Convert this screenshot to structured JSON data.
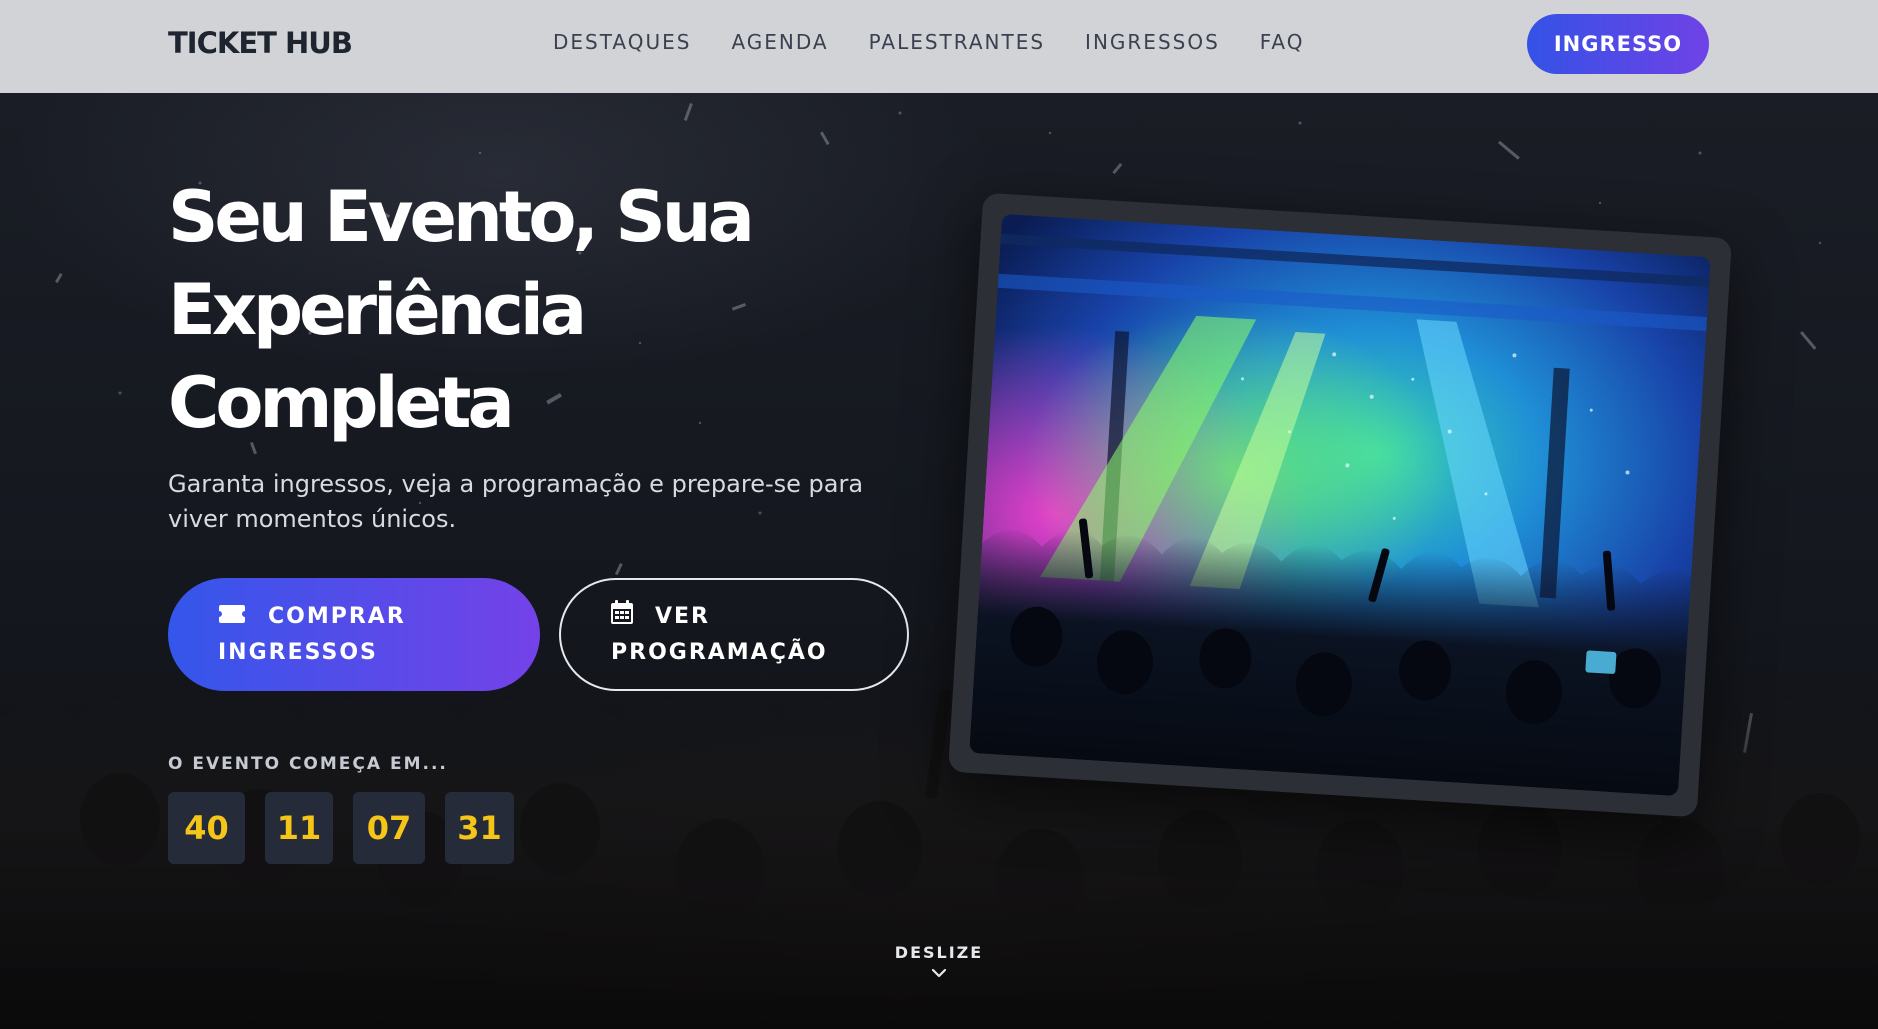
{
  "nav": {
    "logo": "TICKET HUB",
    "links": [
      "DESTAQUES",
      "AGENDA",
      "PALESTRANTES",
      "INGRESSOS",
      "FAQ"
    ],
    "cta": "INGRESSO"
  },
  "hero": {
    "headline_lines": [
      "Seu Evento, Sua",
      "Experiência",
      "Completa"
    ],
    "subtitle_lines": [
      "Garanta ingressos, veja a programação e prepare-se para",
      "viver momentos únicos."
    ],
    "primary_button": {
      "line1": "COMPRAR",
      "line2": "INGRESSOS",
      "icon": "ticket-icon"
    },
    "secondary_button": {
      "line1": "VER",
      "line2": "PROGRAMAÇÃO",
      "icon": "calendar-icon"
    },
    "countdown_label": "O EVENTO COMEÇA EM...",
    "countdown": [
      "40",
      "11",
      "07",
      "31"
    ],
    "scroll_label": "DESLIZE",
    "scroll_icon": "chevron-down-icon"
  },
  "colors": {
    "accent_start": "#3456ea",
    "accent_end": "#7442e8",
    "countdown_digits": "#f5c518",
    "navbar_bg": "#d1d3d6"
  }
}
